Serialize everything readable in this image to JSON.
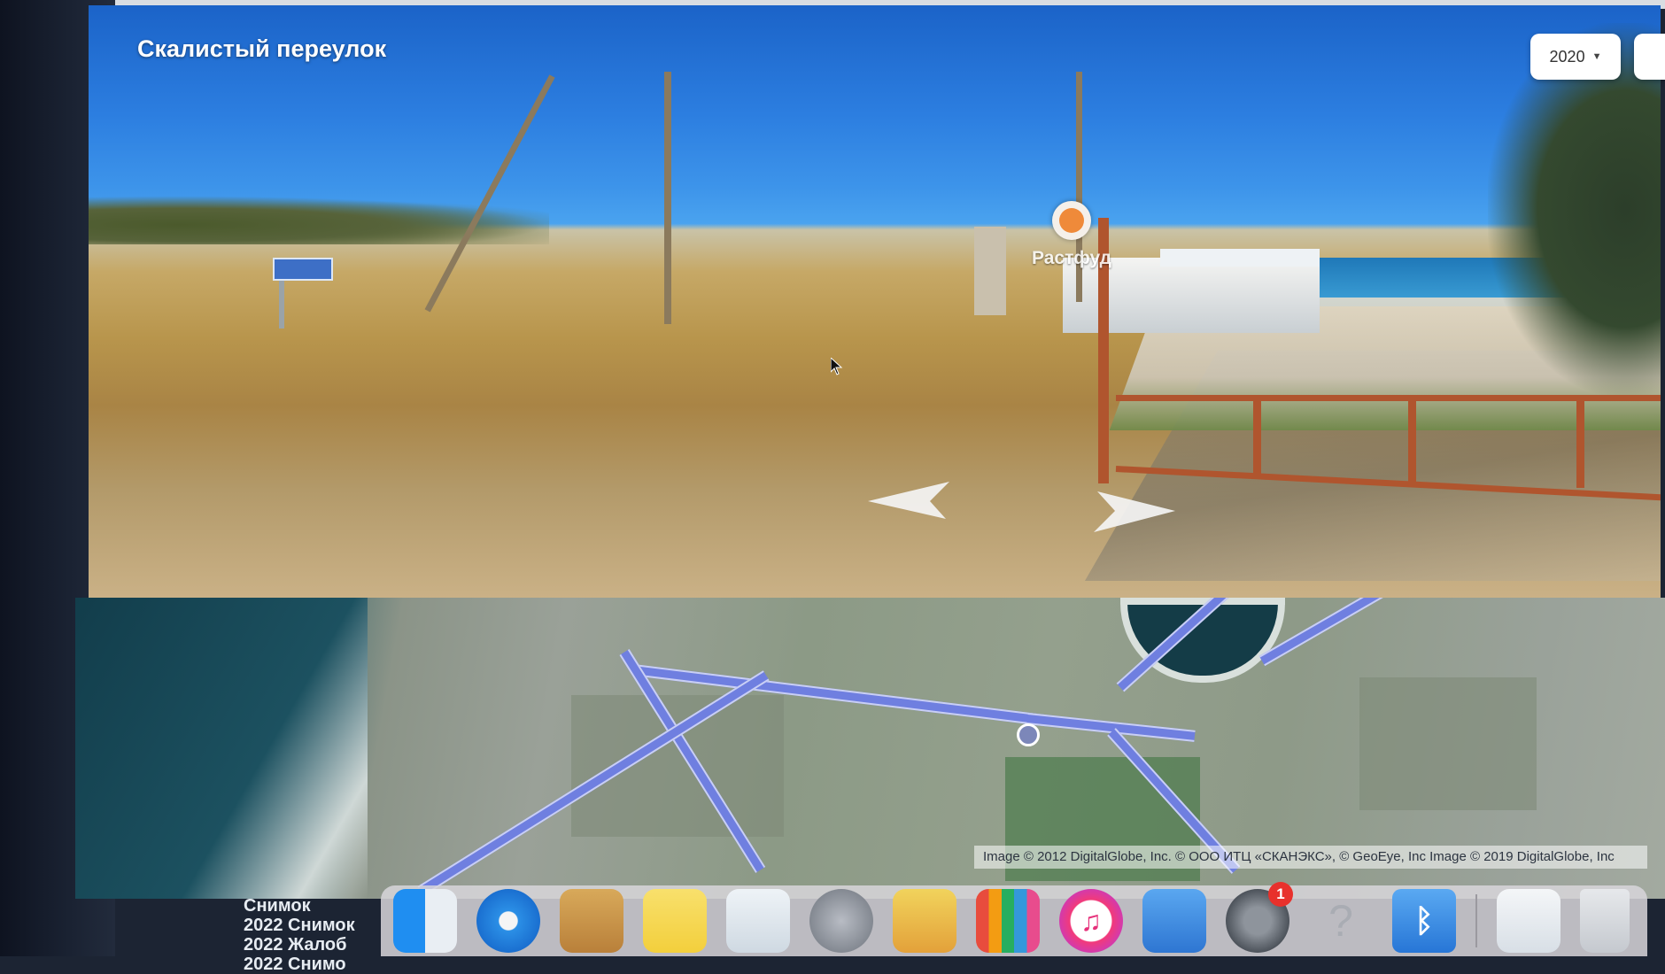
{
  "panorama": {
    "street_title": "Скалистый переулок",
    "year_selector": {
      "value": "2020"
    },
    "poi": {
      "label": "Растфуд",
      "color": "#ef8a3a"
    }
  },
  "map": {
    "copyright": "Image © 2012 DigitalGlobe, Inc. © ООО ИТЦ «СКАНЭКС», © GeoEye, Inc Image © 2019 DigitalGlobe, Inc"
  },
  "desktop": {
    "files": [
      "Снимок",
      "2022 Снимок",
      "2022 Жалоб",
      "2022 Снимо"
    ]
  },
  "dock": {
    "items": [
      {
        "name": "finder-icon"
      },
      {
        "name": "safari-icon"
      },
      {
        "name": "notes-folder-icon"
      },
      {
        "name": "stickies-icon"
      },
      {
        "name": "preview-icon"
      },
      {
        "name": "launchpad-icon"
      },
      {
        "name": "photo-booth-icon"
      },
      {
        "name": "numbers-icon"
      },
      {
        "name": "itunes-icon"
      },
      {
        "name": "keynote-icon"
      },
      {
        "name": "system-preferences-icon",
        "badge": "1"
      },
      {
        "name": "help-icon"
      },
      {
        "name": "bluetooth-icon"
      },
      {
        "name": "document-icon"
      },
      {
        "name": "trash-icon"
      }
    ]
  },
  "colors": {
    "route": "#6f7fe0",
    "badge": "#e8312c"
  }
}
